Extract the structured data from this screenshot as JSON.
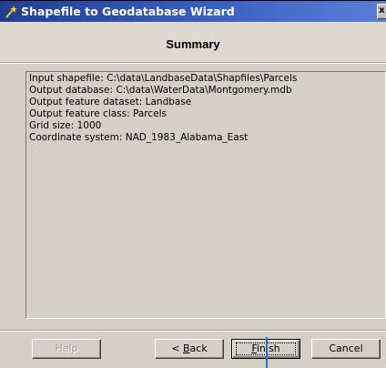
{
  "window": {
    "title": "Shapefile to Geodatabase Wizard",
    "close_glyph": "x"
  },
  "header": {
    "title": "Summary"
  },
  "summary": {
    "lines": [
      "Input shapefile:  C:\\data\\LandbaseData\\Shapfiles\\Parcels",
      "Output database:  C:\\data\\WaterData\\Montgomery.mdb",
      "Output feature dataset:  Landbase",
      "Output feature class: Parcels",
      "Grid size:  1000",
      "Coordinate system: NAD_1983_Alabama_East"
    ]
  },
  "buttons": {
    "help": {
      "label": "Help",
      "enabled": false
    },
    "back": {
      "prefix": "< ",
      "accel": "B",
      "rest": "ack",
      "enabled": true
    },
    "finish": {
      "accel": "F",
      "rest": "inish",
      "enabled": true,
      "default": true
    },
    "cancel": {
      "label": "Cancel",
      "enabled": true
    }
  },
  "icons": {
    "title_icon": "wizard-wand-icon"
  },
  "colors": {
    "titlebar_start": "#1f3e92",
    "titlebar_end": "#5a7fd6",
    "dialog_face": "#d4d0c8",
    "pointer": "#2a6fd1"
  }
}
